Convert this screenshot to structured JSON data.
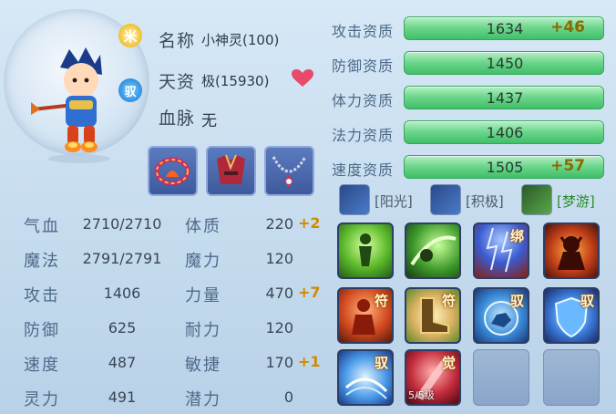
{
  "pet": {
    "name_label": "名称",
    "name_value": "小神灵(100)",
    "talent_label": "天资",
    "talent_value": "极(15930)",
    "bloodline_label": "血脉",
    "bloodline_value": "无",
    "badge_sun": "米",
    "badge_yu": "驭"
  },
  "equipment": [
    "bracelet-icon",
    "armor-icon",
    "necklace-icon"
  ],
  "stats": [
    {
      "label": "气血",
      "value": "2710/2710",
      "label2": "体质",
      "value2": "220",
      "bonus2": "+2"
    },
    {
      "label": "魔法",
      "value": "2791/2791",
      "label2": "魔力",
      "value2": "120",
      "bonus2": ""
    },
    {
      "label": "攻击",
      "value": "1406",
      "label2": "力量",
      "value2": "470",
      "bonus2": "+7"
    },
    {
      "label": "防御",
      "value": "625",
      "label2": "耐力",
      "value2": "120",
      "bonus2": ""
    },
    {
      "label": "速度",
      "value": "487",
      "label2": "敏捷",
      "value2": "170",
      "bonus2": "+1"
    },
    {
      "label": "灵力",
      "value": "491",
      "label2": "潜力",
      "value2": "0",
      "bonus2": ""
    }
  ],
  "aptitudes": [
    {
      "label": "攻击资质",
      "value": "1634",
      "bonus": "+46",
      "fill": 1.0
    },
    {
      "label": "防御资质",
      "value": "1450",
      "bonus": "",
      "fill": 1.0
    },
    {
      "label": "体力资质",
      "value": "1437",
      "bonus": "",
      "fill": 1.0
    },
    {
      "label": "法力资质",
      "value": "1406",
      "bonus": "",
      "fill": 1.0
    },
    {
      "label": "速度资质",
      "value": "1505",
      "bonus": "+57",
      "fill": 1.0
    }
  ],
  "traits": [
    {
      "text": "[阳光]",
      "color": "#4a5a70"
    },
    {
      "text": "[积极]",
      "color": "#4a5a70"
    },
    {
      "text": "[梦游]",
      "color": "#2e8a2e"
    }
  ],
  "skills": [
    {
      "icon": "green-aura-icon",
      "tag": ""
    },
    {
      "icon": "green-slash-icon",
      "tag": ""
    },
    {
      "icon": "lightning-bind-icon",
      "tag": "绑"
    },
    {
      "icon": "demon-fire-icon",
      "tag": ""
    },
    {
      "icon": "red-figure-icon",
      "tag": "符"
    },
    {
      "icon": "boot-icon",
      "tag": "符"
    },
    {
      "icon": "beast-orb-icon",
      "tag": "驭"
    },
    {
      "icon": "shield-icon",
      "tag": "驭"
    },
    {
      "icon": "water-swirl-icon",
      "tag": "驭"
    },
    {
      "icon": "red-awaken-icon",
      "tag": "觉",
      "level": "5/5级"
    }
  ],
  "colors": {
    "bonus": "#d08a00",
    "bar": "#6fd78e",
    "heart": "#e84a6a"
  }
}
